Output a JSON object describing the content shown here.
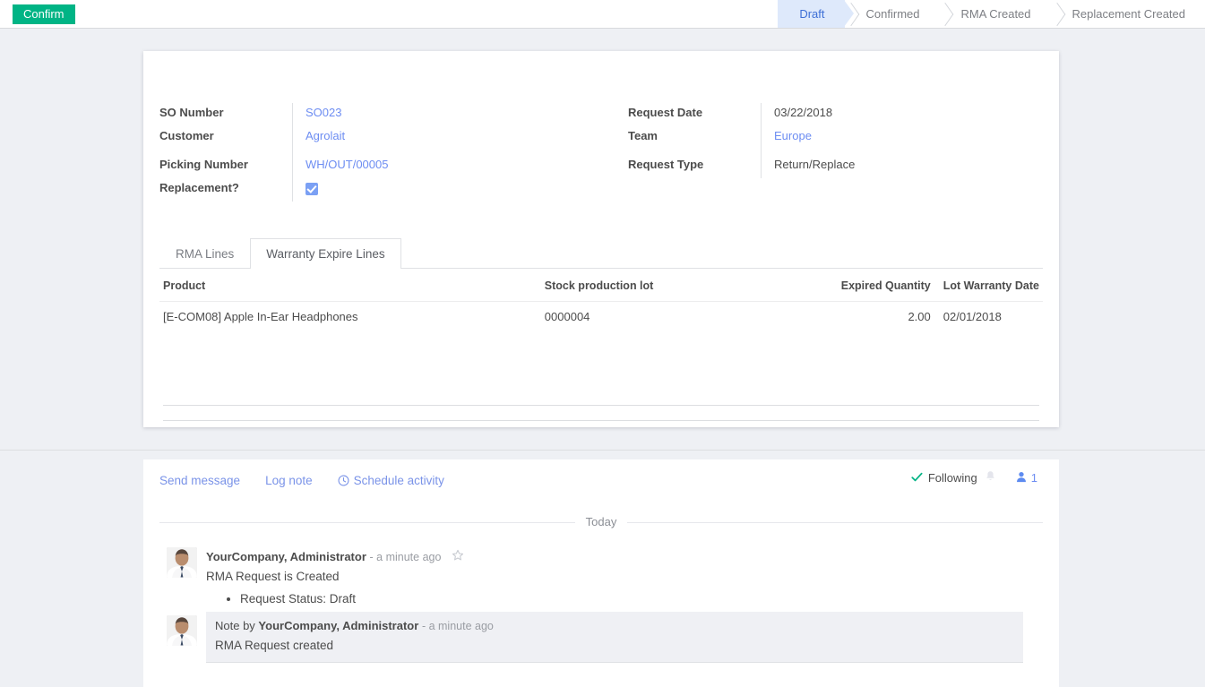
{
  "control_panel": {
    "confirm_label": "Confirm",
    "status_steps": [
      {
        "label": "Draft",
        "active": true
      },
      {
        "label": "Confirmed",
        "active": false
      },
      {
        "label": "RMA Created",
        "active": false
      },
      {
        "label": "Replacement Created",
        "active": false
      }
    ]
  },
  "form": {
    "left_fields": [
      {
        "label": "SO Number",
        "value": "SO023",
        "type": "link"
      },
      {
        "label": "Customer",
        "value": "Agrolait",
        "type": "link"
      },
      {
        "label": "Picking Number",
        "value": "WH/OUT/00005",
        "type": "link"
      },
      {
        "label": "Replacement?",
        "value": "",
        "type": "checkbox",
        "checked": true
      }
    ],
    "right_fields": [
      {
        "label": "Request Date",
        "value": "03/22/2018",
        "type": "text"
      },
      {
        "label": "Team",
        "value": "Europe",
        "type": "link"
      },
      {
        "label": "Request Type",
        "value": "Return/Replace",
        "type": "text"
      }
    ]
  },
  "notebook": {
    "tabs": [
      {
        "label": "RMA Lines",
        "active": false
      },
      {
        "label": "Warranty Expire Lines",
        "active": true
      }
    ],
    "table": {
      "headers": [
        "Product",
        "Stock production lot",
        "Expired Quantity",
        "Lot Warranty Date"
      ],
      "rows": [
        {
          "product": "[E-COM08] Apple In-Ear Headphones",
          "lot": "0000004",
          "qty": "2.00",
          "warranty_date": "02/01/2018"
        }
      ]
    }
  },
  "chatter": {
    "send_message_label": "Send message",
    "log_note_label": "Log note",
    "schedule_activity_label": "Schedule activity",
    "schedule_activity_icon": "clock-icon",
    "following_label": "Following",
    "following_icon": "check-icon",
    "bell_icon": "bell-icon",
    "followers_icon": "user-icon",
    "followers_count": "1",
    "date_separator": "Today",
    "messages": [
      {
        "kind": "message",
        "avatar": "user-avatar",
        "author": "YourCompany, Administrator",
        "meta": "- a minute ago",
        "starred": false,
        "star_icon": "star-outline-icon",
        "text": "RMA Request is Created",
        "bullets": [
          "Request Status: Draft"
        ]
      },
      {
        "kind": "note",
        "avatar": "user-avatar",
        "prefix": "Note by ",
        "author": "YourCompany, Administrator",
        "meta": "- a minute ago",
        "text": "RMA Request created",
        "bullets": []
      }
    ]
  },
  "colors": {
    "accent_green": "#00b485",
    "link_blue": "#6d8df2",
    "active_step_bg": "#dee9fb",
    "active_step_text": "#3d6fd6",
    "page_bg": "#eef0f4",
    "note_bg": "#eff0f4"
  }
}
